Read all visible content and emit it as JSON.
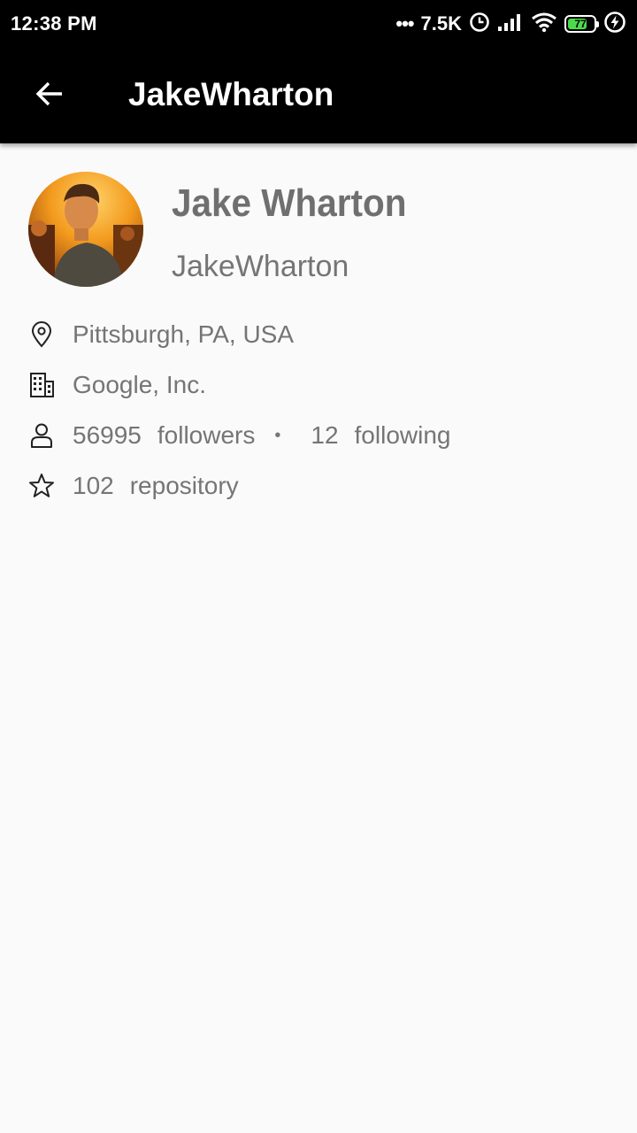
{
  "status_bar": {
    "time": "12:38 PM",
    "more": "•••",
    "net_speed": "7.5K",
    "battery_level": "77",
    "battery_fraction": 0.77
  },
  "app_bar": {
    "title": "JakeWharton",
    "back_icon": "arrow-back-icon"
  },
  "profile": {
    "name": "Jake Wharton",
    "login": "JakeWharton",
    "location": "Pittsburgh, PA, USA",
    "company": "Google, Inc.",
    "followers_count": "56995",
    "followers_label": "followers",
    "separator": "•",
    "following_count": "12",
    "following_label": "following",
    "repos_count": "102",
    "repos_label": "repository"
  },
  "icons": {
    "location": "location-pin-icon",
    "company": "building-icon",
    "people": "person-icon",
    "repos": "star-icon"
  },
  "colors": {
    "status_bar": "#000000",
    "app_bar": "#000000",
    "background": "#fafafa",
    "text_secondary": "#757575",
    "battery": "#4cd94c"
  }
}
